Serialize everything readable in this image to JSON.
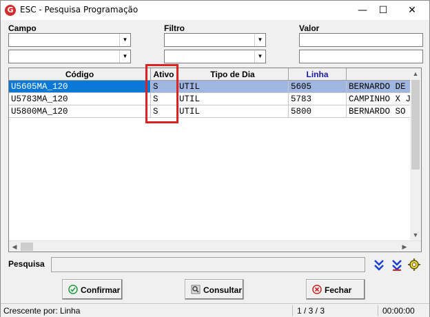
{
  "window": {
    "title": "ESC - Pesquisa Programação",
    "app_icon": "G",
    "minimize": "—",
    "maximize": "☐",
    "close": "✕"
  },
  "filters": {
    "campo_label": "Campo",
    "filtro_label": "Filtro",
    "valor_label": "Valor"
  },
  "grid": {
    "columns": [
      "Código",
      "Ativo",
      "Tipo de Dia",
      "Linha",
      ""
    ],
    "rows": [
      [
        "U5605MA_120",
        "S",
        "UTIL",
        "5605",
        "BERNARDO DE"
      ],
      [
        "U5783MA_120",
        "S",
        "UTIL",
        "5783",
        "CAMPINHO X J"
      ],
      [
        "U5800MA_120",
        "S",
        "UTIL",
        "5800",
        "BERNARDO SO"
      ]
    ],
    "selected_row": 0,
    "highlight_color": "#e02020",
    "linha_header_color": "#1a1aa6"
  },
  "search": {
    "label": "Pesquisa",
    "value": ""
  },
  "buttons": {
    "confirm": "Confirmar",
    "consult": "Consultar",
    "close": "Fechar"
  },
  "status": {
    "sort": "Crescente por: Linha",
    "count": "1 / 3 / 3",
    "time": "00:00:00"
  }
}
